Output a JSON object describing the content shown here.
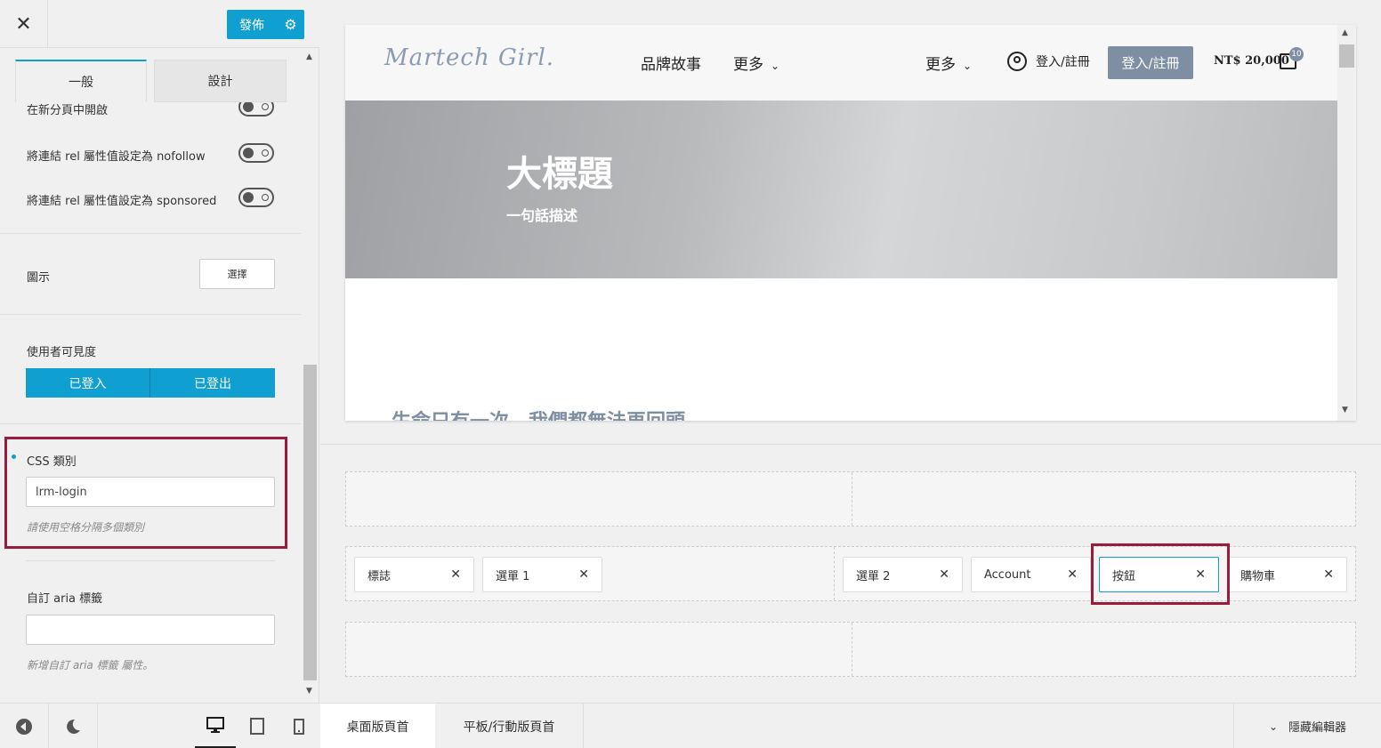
{
  "sidebar": {
    "publish_label": "發佈",
    "tabs": [
      {
        "label": "一般"
      },
      {
        "label": "設計"
      }
    ],
    "rows": {
      "new_tab_label": "在新分頁中開啟",
      "nofollow_label": "將連結 rel 屬性值設定為 nofollow",
      "sponsored_label": "將連結 rel 屬性值設定為 sponsored",
      "icon_label": "圖示",
      "icon_select_label": "選擇",
      "visibility_label": "使用者可見度",
      "visibility_options": [
        "已登入",
        "已登出"
      ],
      "css_class_label": "CSS 類別",
      "css_class_value": "lrm-login",
      "css_class_hint": "請使用空格分隔多個類別",
      "aria_label": "自訂 aria 標籤",
      "aria_value": "",
      "aria_hint": "新增自訂 aria 標籤 屬性。"
    }
  },
  "preview": {
    "logo_text": "Martech Girl.",
    "nav": [
      {
        "label": "品牌故事"
      },
      {
        "label": "更多"
      },
      {
        "label": "更多"
      }
    ],
    "login_link": "登入/註冊",
    "login_button": "登入/註冊",
    "price": "NT$ 20,000",
    "cart_count": "10",
    "hero_title": "大標題",
    "hero_subtitle": "一句話描述",
    "body_heading": "生命只有一次，我們都無法再回頭"
  },
  "builder": {
    "chips": [
      {
        "label": "標誌"
      },
      {
        "label": "選單 1"
      },
      {
        "label": "選單 2"
      },
      {
        "label": "Account"
      },
      {
        "label": "按鈕"
      },
      {
        "label": "購物車"
      }
    ]
  },
  "bottom": {
    "tabs": [
      {
        "label": "桌面版頁首"
      },
      {
        "label": "平板/行動版頁首"
      }
    ],
    "hide_editor": "隱藏編輯器"
  }
}
